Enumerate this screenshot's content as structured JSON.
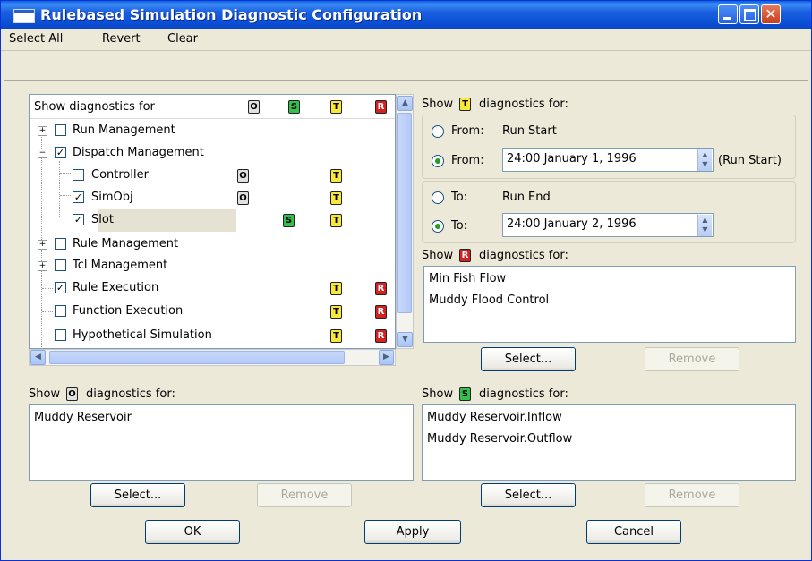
{
  "window": {
    "title": "Rulebased Simulation Diagnostic Configuration"
  },
  "menu": [
    "Select All",
    "Revert",
    "Clear"
  ],
  "tree": {
    "header": "Show diagnostics for",
    "columns": [
      "O",
      "S",
      "T",
      "R"
    ],
    "rows": [
      {
        "label": "Run Management",
        "checked": false,
        "expander": "+"
      },
      {
        "label": "Dispatch Management",
        "checked": true,
        "expander": "-"
      },
      {
        "label": "Controller",
        "checked": false
      },
      {
        "label": "SimObj",
        "checked": true
      },
      {
        "label": "Slot",
        "checked": true,
        "selected": true
      },
      {
        "label": "Rule Management",
        "checked": false,
        "expander": "+"
      },
      {
        "label": "Tcl Management",
        "checked": false,
        "expander": "+"
      },
      {
        "label": "Rule Execution",
        "checked": true
      },
      {
        "label": "Function Execution",
        "checked": false
      },
      {
        "label": "Hypothetical Simulation",
        "checked": false
      }
    ]
  },
  "t_section": {
    "show": "Show",
    "tag": "T",
    "suffix": "diagnostics for:",
    "from_label_1": "From:",
    "from_value_1": "Run Start",
    "from_label_2": "From:",
    "from_value_2": "24:00 January 1, 1996",
    "from_note": "(Run Start)",
    "to_label_1": "To:",
    "to_value_1": "Run End",
    "to_label_2": "To:",
    "to_value_2": "24:00 January 2, 1996"
  },
  "r_section": {
    "show": "Show",
    "tag": "R",
    "suffix": "diagnostics for:",
    "items": [
      "Min Fish Flow",
      "Muddy Flood Control"
    ],
    "select": "Select...",
    "remove": "Remove"
  },
  "o_section": {
    "show": "Show",
    "tag": "O",
    "suffix": "diagnostics for:",
    "items": [
      "Muddy Reservoir"
    ],
    "select": "Select...",
    "remove": "Remove"
  },
  "s_section": {
    "show": "Show",
    "tag": "S",
    "suffix": "diagnostics for:",
    "items": [
      "Muddy Reservoir.Inflow",
      "Muddy Reservoir.Outflow"
    ],
    "select": "Select...",
    "remove": "Remove"
  },
  "footer": {
    "ok": "OK",
    "apply": "Apply",
    "cancel": "Cancel"
  },
  "colors": {
    "title_bar": "#0b4fd6",
    "dialog_bg": "#ece9d8",
    "tag_o": "#e0e0e0",
    "tag_s": "#34c04a",
    "tag_t": "#f7e83a",
    "tag_r": "#d22222"
  }
}
